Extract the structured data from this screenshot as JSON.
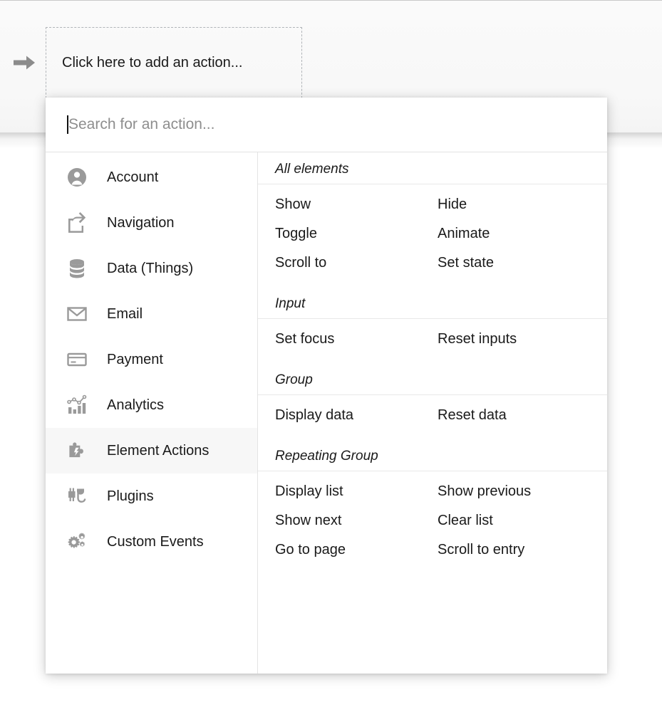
{
  "workflow": {
    "arrow_icon": "arrow-right-icon",
    "add_action_label": "Click here to add an action..."
  },
  "dropdown": {
    "search": {
      "placeholder": "Search for an action...",
      "value": ""
    },
    "categories": [
      {
        "label": "Account",
        "icon": "user-circle-icon",
        "active": false
      },
      {
        "label": "Navigation",
        "icon": "share-export-icon",
        "active": false
      },
      {
        "label": "Data (Things)",
        "icon": "database-icon",
        "active": false
      },
      {
        "label": "Email",
        "icon": "envelope-icon",
        "active": false
      },
      {
        "label": "Payment",
        "icon": "credit-card-icon",
        "active": false
      },
      {
        "label": "Analytics",
        "icon": "bar-chart-icon",
        "active": false
      },
      {
        "label": "Element Actions",
        "icon": "puzzle-bolt-icon",
        "active": true
      },
      {
        "label": "Plugins",
        "icon": "plug-icon",
        "active": false
      },
      {
        "label": "Custom Events",
        "icon": "gears-icon",
        "active": false
      }
    ],
    "sections": [
      {
        "title": "All elements",
        "actions": [
          "Show",
          "Hide",
          "Toggle",
          "Animate",
          "Scroll to",
          "Set state"
        ]
      },
      {
        "title": "Input",
        "actions": [
          "Set focus",
          "Reset inputs"
        ]
      },
      {
        "title": "Group",
        "actions": [
          "Display data",
          "Reset data"
        ]
      },
      {
        "title": "Repeating Group",
        "actions": [
          "Display list",
          "Show previous",
          "Show next",
          "Clear list",
          "Go to page",
          "Scroll to entry"
        ]
      }
    ]
  },
  "colors": {
    "icon_gray": "#9a9a9a",
    "text": "#1a1a1a",
    "placeholder": "#8e8e8e",
    "active_row": "#f7f7f7",
    "divider": "#e3e3e3"
  }
}
